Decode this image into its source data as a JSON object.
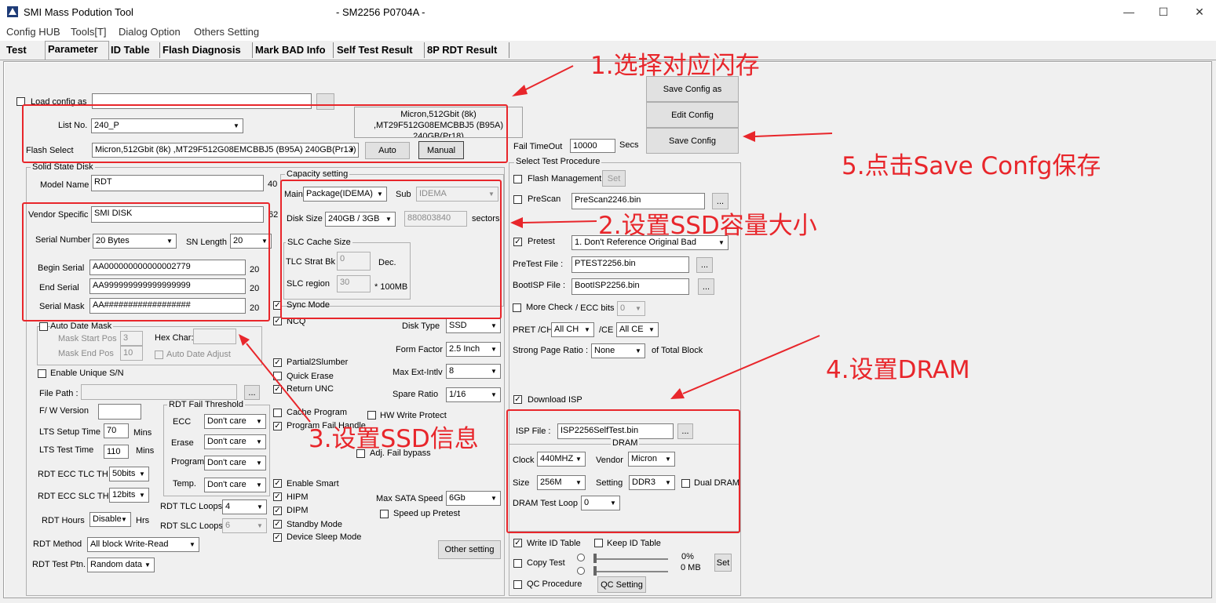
{
  "window": {
    "app_title": "SMI Mass Podution Tool",
    "center_title": "- SM2256 P0704A -"
  },
  "menu": [
    "Config HUB",
    "Tools[T]",
    "Dialog Option",
    "Others Setting"
  ],
  "tabs": [
    "Test",
    "Parameter",
    "ID Table",
    "Flash Diagnosis",
    "Mark BAD Info",
    "Self Test Result",
    "8P RDT Result"
  ],
  "top": {
    "load_config_label": "Load config as",
    "list_no_label": "List No.",
    "list_no_value": "240_P",
    "flash_select_label": "Flash Select",
    "flash_select_value": "Micron,512Gbit (8k) ,MT29F512G08EMCBBJ5 (B95A) 240GB(Pr13)",
    "auto_btn": "Auto",
    "manual_btn": "Manual",
    "flash_info": [
      "Micron,512Gbit (8k)",
      ",MT29F512G08EMCBBJ5 (B95A)",
      "240GB(Pr18)"
    ],
    "save_config_as": "Save Config as",
    "edit_config": "Edit Config",
    "save_config": "Save Config",
    "fail_time_label": "Fail TimeOut",
    "fail_time_value": "10000",
    "secs": "Secs"
  },
  "ssd": {
    "group": "Solid State Disk",
    "model_label": "Model Name",
    "model_value": "RDT",
    "model_len": "40",
    "vendor_label": "Vendor Specific",
    "vendor_value": "SMI DISK",
    "vendor_len": "62",
    "serial_label": "Serial Number",
    "serial_value": "20 Bytes",
    "sn_length_label": "SN Length",
    "sn_length_value": "20",
    "begin_label": "Begin Serial",
    "begin_value": "AA000000000000002779",
    "begin_len": "20",
    "end_label": "End Serial",
    "end_value": "AA999999999999999999",
    "end_len": "20",
    "mask_label": "Serial Mask",
    "mask_value": "AA##################",
    "mask_len": "20",
    "auto_date_label": "Auto Date Mask",
    "mask_start_label": "Mask Start Pos",
    "mask_start_value": "3",
    "mask_end_label": "Mask End Pos",
    "mask_end_value": "10",
    "hex_char_label": "Hex Char:",
    "auto_date_adjust": "Auto Date Adjust",
    "unique_sn_label": "Enable Unique S/N",
    "file_path_label": "File Path :",
    "browse": "...",
    "fw_label": "F/ W Version",
    "lts_setup_label": "LTS Setup Time",
    "lts_setup_value": "70",
    "mins": "Mins",
    "lts_test_label": "LTS Test Time",
    "lts_test_value": "110",
    "ecc_tlc_label": "RDT ECC TLC TH",
    "ecc_tlc_value": "50bits",
    "ecc_slc_label": "RDT ECC SLC TH",
    "ecc_slc_value": "12bits",
    "rdt_hours_label": "RDT Hours",
    "rdt_hours_value": "Disable",
    "hrs": "Hrs",
    "rdt_method_label": "RDT Method",
    "rdt_method_value": "All block Write-Read",
    "rdt_ptn_label": "RDT Test Ptn.",
    "rdt_ptn_value": "Random data",
    "fail_group": "RDT Fail Threshold",
    "ecc_label": "ECC",
    "ecc_value": "Don't care",
    "erase_label": "Erase",
    "erase_value": "Don't care",
    "program_label": "Program",
    "program_value": "Don't care",
    "temp_label": "Temp.",
    "temp_value": "Don't care",
    "tlc_loops_label": "RDT TLC Loops",
    "tlc_loops_value": "4",
    "slc_loops_label": "RDT SLC Loops",
    "slc_loops_value": "6"
  },
  "capacity": {
    "group": "Capacity setting",
    "main_label": "Main",
    "main_value": "Package(IDEMA)",
    "sub_label": "Sub",
    "sub_value": "IDEMA",
    "disk_size_label": "Disk Size",
    "disk_size_value": "240GB / 3GB",
    "sectors_value": "880803840",
    "sectors": "sectors",
    "slc_group": "SLC Cache Size",
    "tlc_strat_label": "TLC Strat Bk",
    "tlc_strat_value": "0",
    "dec": "Dec.",
    "slc_region_label": "SLC region",
    "slc_region_value": "30",
    "mb": "* 100MB"
  },
  "options": {
    "sync_mode": "Sync Mode",
    "ncq": "NCQ",
    "disk_type_label": "Disk Type",
    "disk_type_value": "SSD",
    "form_factor_label": "Form Factor",
    "form_factor_value": "2.5 Inch",
    "max_ext_label": "Max Ext-Intlv",
    "max_ext_value": "8",
    "spare_label": "Spare Ratio",
    "spare_value": "1/16",
    "partial2slumber": "Partial2Slumber",
    "quick_erase": "Quick Erase",
    "return_unc": "Return UNC",
    "cache_program": "Cache Program",
    "hw_write_protect": "HW Write Protect",
    "program_fail_handle": "Program Fail Handle",
    "adj_fail_bypass": "Adj. Fail bypass",
    "enable_smart": "Enable Smart",
    "hipm": "HIPM",
    "dipm": "DIPM",
    "standby_mode": "Standby Mode",
    "device_sleep": "Device Sleep Mode",
    "max_sata_label": "Max SATA Speed",
    "max_sata_value": "6Gb",
    "speed_up_pretest": "Speed up Pretest",
    "other_setting": "Other setting"
  },
  "procedure": {
    "group": "Select Test Procedure",
    "flash_mgmt": "Flash Management",
    "set": "Set",
    "prescan": "PreScan",
    "prescan_file": "PreScan2246.bin",
    "pretest": "Pretest",
    "pretest_value": "1. Don't Reference Original Bad",
    "pretest_file_label": "PreTest File :",
    "pretest_file": "PTEST2256.bin",
    "bootisp_label": "BootISP File :",
    "bootisp_file": "BootISP2256.bin",
    "more_check": "More Check",
    "ecc_bits_label": "/ ECC bits",
    "ecc_bits_value": "0",
    "pret_label": "PRET /CH",
    "pret_value": "All CH",
    "ce_label": "/CE",
    "ce_value": "All CE",
    "strong_label": "Strong Page Ratio :",
    "strong_value": "None",
    "of_total": "of Total Block",
    "download_isp": "Download ISP",
    "isp_file_label": "ISP File :",
    "isp_file": "ISP2256SelfTest.bin",
    "dram_group": "DRAM",
    "clock_label": "Clock",
    "clock_value": "440MHZ",
    "vendor_label": "Vendor",
    "vendor_value": "Micron",
    "size_label": "Size",
    "size_value": "256M",
    "setting_label": "Setting",
    "setting_value": "DDR3",
    "dual_dram": "Dual DRAM",
    "dram_loop_label": "DRAM Test Loop",
    "dram_loop_value": "0",
    "write_id": "Write ID Table",
    "keep_id": "Keep ID Table",
    "copy_test": "Copy Test",
    "pct": "0%",
    "mb_val": "0 MB",
    "set2": "Set",
    "qc_procedure": "QC Procedure",
    "qc_setting": "QC Setting"
  },
  "annotations": {
    "a1": "1.选择对应闪存",
    "a2": "2.设置SSD容量大小",
    "a3": "3.设置SSD信息",
    "a4": "4.设置DRAM",
    "a5": "5.点击Save Confg保存"
  },
  "colors": {
    "annotation": "#e8262b"
  }
}
